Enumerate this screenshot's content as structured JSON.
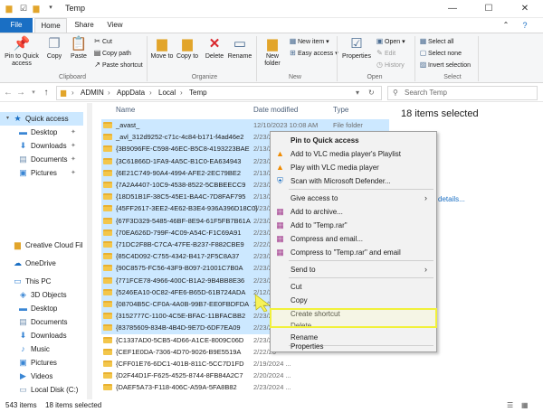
{
  "window": {
    "title": "Temp",
    "controls": [
      "—",
      "☐",
      "✕"
    ]
  },
  "ribbon_tabs": [
    "File",
    "Home",
    "Share",
    "View"
  ],
  "ribbon": {
    "clipboard": {
      "pin_label": "Pin to Quick access",
      "copy_label": "Copy",
      "paste_label": "Paste",
      "cut_label": "Cut",
      "copy_path_label": "Copy path",
      "paste_shortcut_label": "Paste shortcut",
      "group_label": "Clipboard"
    },
    "organize": {
      "move_label": "Move to",
      "copy_to_label": "Copy to",
      "delete_label": "Delete",
      "rename_label": "Rename",
      "group_label": "Organize"
    },
    "new": {
      "new_folder_label": "New folder",
      "new_item_label": "New item",
      "easy_access_label": "Easy access",
      "group_label": "New"
    },
    "open": {
      "properties_label": "Properties",
      "open_label": "Open",
      "edit_label": "Edit",
      "history_label": "History",
      "group_label": "Open"
    },
    "select": {
      "select_all_label": "Select all",
      "select_none_label": "Select none",
      "invert_label": "Invert selection",
      "group_label": "Select"
    }
  },
  "address": {
    "crumbs": [
      "ADMIN",
      "AppData",
      "Local",
      "Temp"
    ],
    "search_placeholder": "Search Temp"
  },
  "nav": {
    "quick_access": "Quick access",
    "items": [
      "Desktop",
      "Downloads",
      "Documents",
      "Pictures"
    ],
    "creative_cloud": "Creative Cloud Fil",
    "onedrive": "OneDrive",
    "this_pc": "This PC",
    "pc_items": [
      "3D Objects",
      "Desktop",
      "Documents",
      "Downloads",
      "Music",
      "Pictures",
      "Videos",
      "Local Disk (C:)"
    ]
  },
  "columns": {
    "name": "Name",
    "date": "Date modified",
    "type": "Type"
  },
  "files": [
    {
      "name": "_avast_",
      "date": "12/10/2023 10:08 AM",
      "type": "File folder"
    },
    {
      "name": "_avl_312d9252-c71c-4c84-b171-f4ad46e2",
      "date": "2/23/20",
      "type": ""
    },
    {
      "name": "{3B9096FE-C598-46EC-B5C8-4193223BAE",
      "date": "2/13/20",
      "type": ""
    },
    {
      "name": "{3C61866D-1FA9-4A5C-B1C0-EA634943",
      "date": "2/23/20",
      "type": ""
    },
    {
      "name": "{6E21C749-90A4-4994-AFE2-2EC79BE2",
      "date": "2/13/20",
      "type": ""
    },
    {
      "name": "{7A2A4407-10C9-4538-8522-5CBBEECC9",
      "date": "2/23/20",
      "type": ""
    },
    {
      "name": "{18D51B1F-38C5-45E1-BA4C-7D8FAF795",
      "date": "2/13/20",
      "type": ""
    },
    {
      "name": "{45FF2617-3EE2-4E62-B3E4-936A396D18C0}",
      "date": "2/23/20",
      "type": ""
    },
    {
      "name": "{67F3D329-5485-46BF-8E94-61F5FB7B61A",
      "date": "2/23/20",
      "type": ""
    },
    {
      "name": "{70EA626D-799F-4C09-A54C-F1C69A91",
      "date": "2/23/20",
      "type": ""
    },
    {
      "name": "{71DC2F8B-C7CA-47FE-B237-F882CBE9",
      "date": "2/22/20",
      "type": ""
    },
    {
      "name": "{85C4D092-C755-4342-B417-2F5C8A37",
      "date": "2/23/20",
      "type": ""
    },
    {
      "name": "{90C8575-FC56-43F9-B097-21001C7B0A",
      "date": "2/23/20",
      "type": ""
    },
    {
      "name": "{771FCE78-4966-400C-B1A2-9B4BB8E36",
      "date": "2/23/20",
      "type": ""
    },
    {
      "name": "{5246EA10-0C82-4FE6-B65D-61B724ADA",
      "date": "2/12/20",
      "type": ""
    },
    {
      "name": "{08704B5C-CF0A-4A0B-99B7-EE0FBDFDA",
      "date": "2/22/20",
      "type": ""
    },
    {
      "name": "{3152777C-1100-4C5E-BFAC-11BFACBB2",
      "date": "2/23/20",
      "type": ""
    },
    {
      "name": "{83785609-834B-4B4D-9E7D-6DF7EA09",
      "date": "2/23/20",
      "type": ""
    },
    {
      "name": "{C1337AD0-5CB5-4D66-A1CE-8009C06D",
      "date": "2/23/20",
      "type": ""
    },
    {
      "name": "{CEF1E0DA-7306-4D70-9026-B9E5519A",
      "date": "2/22/20",
      "type": ""
    },
    {
      "name": "{CFF01E76-6DC1-401B-811C-5CC7D1FD",
      "date": "2/19/2024 ...",
      "type": ""
    },
    {
      "name": "{D2F44D1F-F625-4525-8744-8FB84A2C7",
      "date": "2/20/2024 ...",
      "type": ""
    },
    {
      "name": "{DAEF5A73-F118-406C-A59A-5FA8B82",
      "date": "2/23/2024 ...",
      "type": ""
    }
  ],
  "details": {
    "selected_text": "18 items selected",
    "link_text": "details..."
  },
  "status": {
    "count": "543 items",
    "selected": "18 items selected"
  },
  "context_menu": {
    "items": [
      {
        "label": "Pin to Quick access",
        "bold": true
      },
      {
        "label": "Add to VLC media player's Playlist"
      },
      {
        "label": "Play with VLC media player"
      },
      {
        "label": "Scan with Microsoft Defender..."
      },
      {
        "label": "Give access to",
        "submenu": true
      },
      {
        "label": "Add to archive..."
      },
      {
        "label": "Add to \"Temp.rar\""
      },
      {
        "label": "Compress and email..."
      },
      {
        "label": "Compress to \"Temp.rar\" and email"
      },
      {
        "label": "Send to",
        "submenu": true
      },
      {
        "label": "Cut"
      },
      {
        "label": "Copy"
      },
      {
        "label": "Create shortcut"
      },
      {
        "label": "Delete"
      },
      {
        "label": "Rename"
      },
      {
        "label": "Properties"
      }
    ]
  },
  "colors": {
    "accent": "#1a6fc4",
    "selection": "#cce8ff",
    "highlight_border": "#f1f13a",
    "folder": "#f3c64b"
  }
}
